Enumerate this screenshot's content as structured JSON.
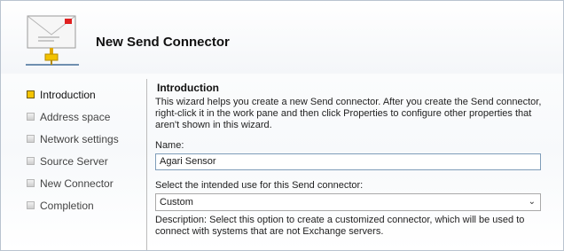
{
  "window": {
    "title": "New Send Connector"
  },
  "nav": {
    "items": [
      {
        "label": "Introduction",
        "active": true
      },
      {
        "label": "Address space",
        "active": false
      },
      {
        "label": "Network settings",
        "active": false
      },
      {
        "label": "Source Server",
        "active": false
      },
      {
        "label": "New Connector",
        "active": false
      },
      {
        "label": "Completion",
        "active": false
      }
    ]
  },
  "content": {
    "section_title": "Introduction",
    "description": "This wizard helps you create a new Send connector. After you create the Send connector, right-click it in the work pane and then click Properties to configure other properties that aren't shown in this wizard.",
    "name_label": "Name:",
    "name_value": "Agari Sensor",
    "use_label": "Select the intended use for this Send connector:",
    "use_value": "Custom",
    "use_description": "Description: Select this option to create a customized connector, which will be used to connect with systems that are not Exchange servers."
  },
  "colors": {
    "active_step": "#f5c400",
    "envelope_flag": "#e02020"
  }
}
